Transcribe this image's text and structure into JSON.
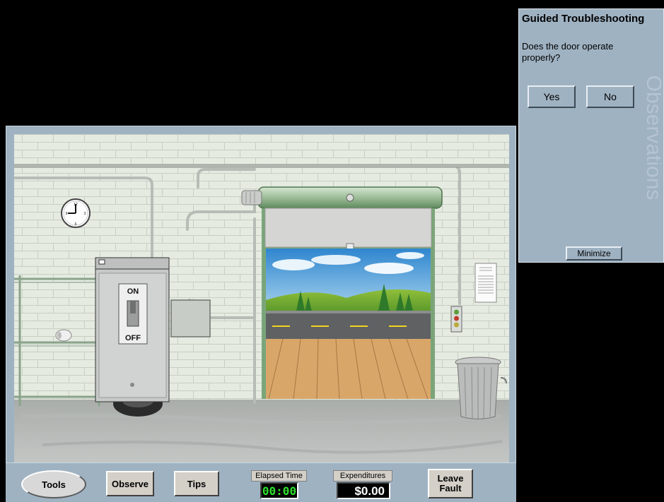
{
  "panel": {
    "title": "Guided Troubleshooting",
    "question": "Does the door operate properly?",
    "yes_label": "Yes",
    "no_label": "No",
    "watermark": "Observations",
    "minimize_label": "Minimize"
  },
  "scene": {
    "switch_on_label": "ON",
    "switch_off_label": "OFF",
    "switch_position": "ON"
  },
  "toolbar": {
    "tools_label": "Tools",
    "observe_label": "Observe",
    "tips_label": "Tips",
    "elapsed_label": "Elapsed Time",
    "elapsed_value": "00:00",
    "expenditures_label": "Expenditures",
    "expenditures_value": "$0.00",
    "leave_fault_line1": "Leave",
    "leave_fault_line2": "Fault"
  },
  "colors": {
    "panel_bg": "#9fb2c2",
    "counter_green": "#2ee02e",
    "door_frame_green": "#7aa57a"
  }
}
